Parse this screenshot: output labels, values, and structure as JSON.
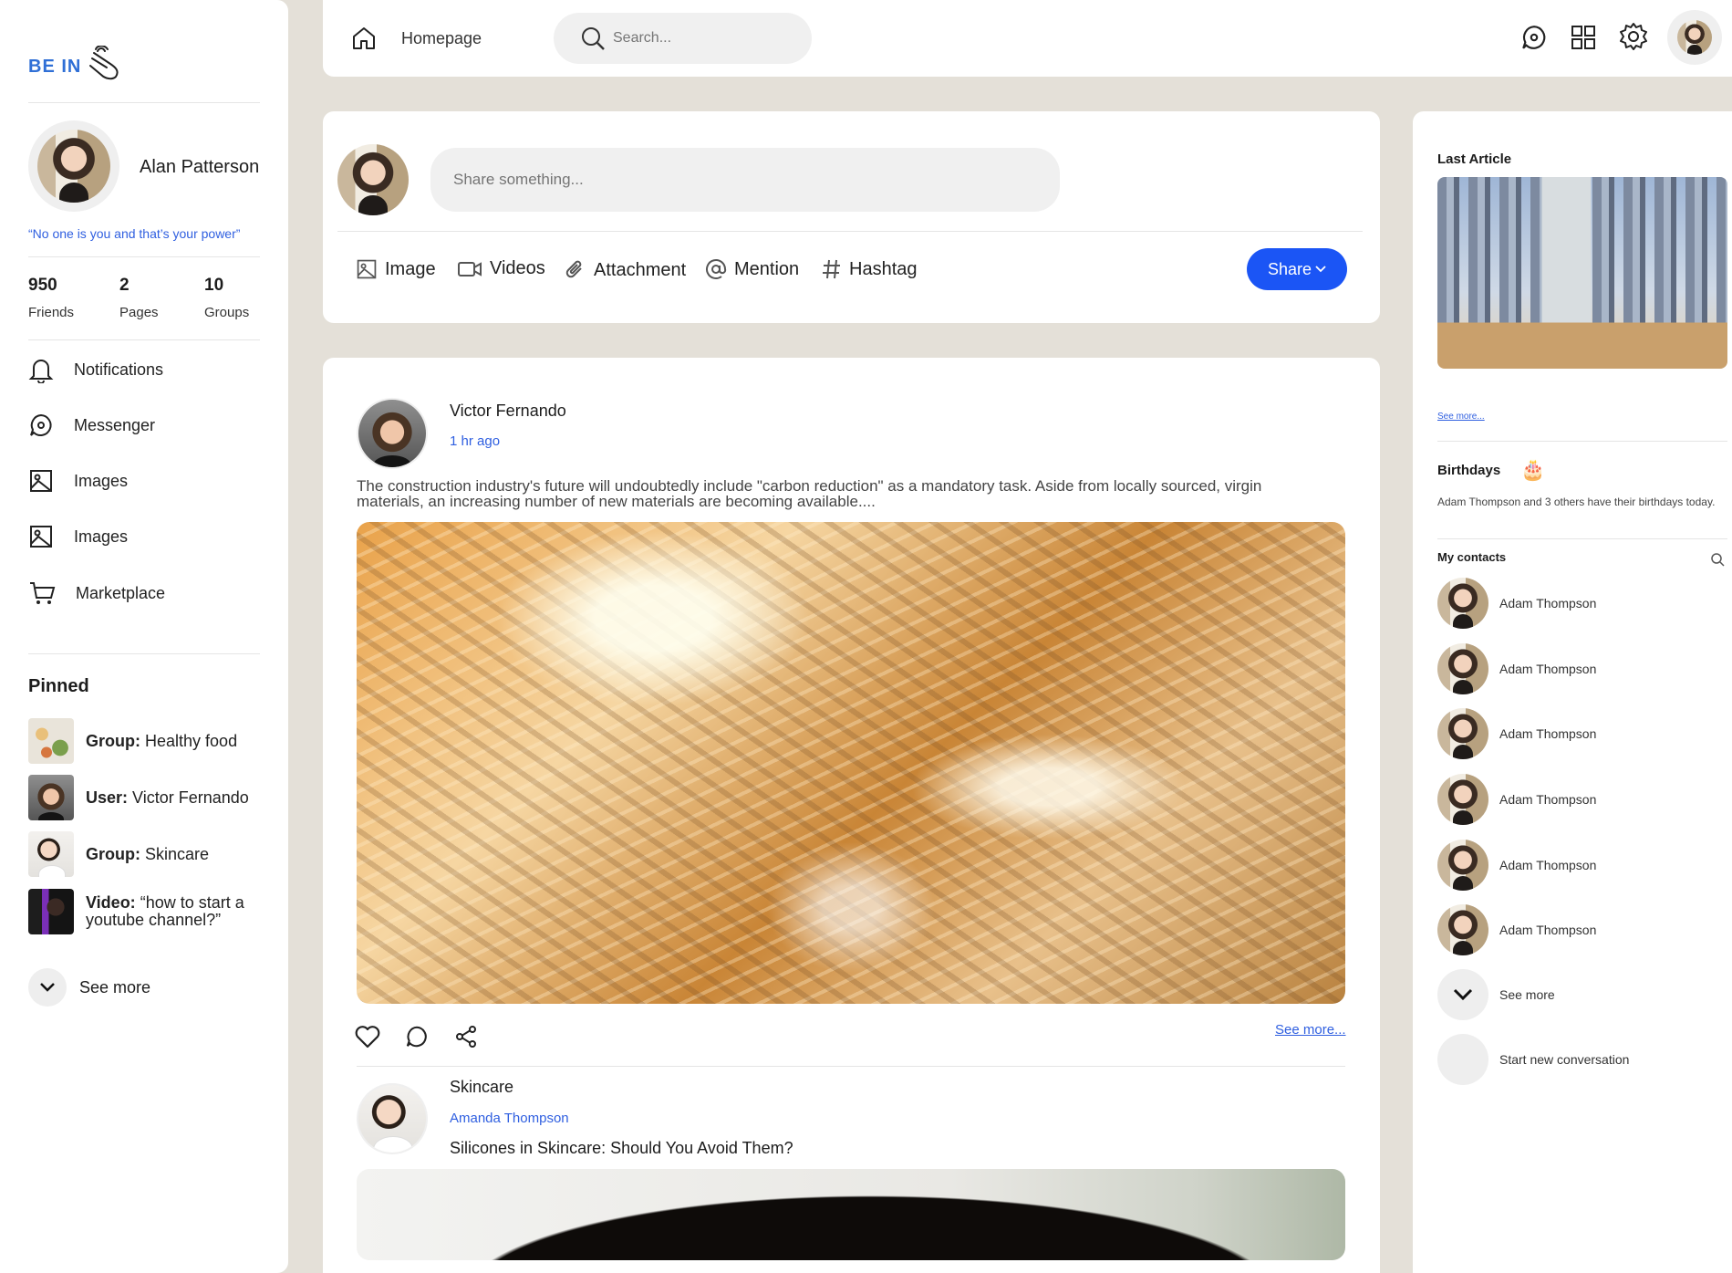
{
  "brand": {
    "logo_text": "BE IN"
  },
  "profile": {
    "name": "Alan Patterson",
    "quote": "“No one is you and that’s your power”",
    "stats": [
      {
        "value": "950",
        "label": "Friends"
      },
      {
        "value": "2",
        "label": "Pages"
      },
      {
        "value": "10",
        "label": "Groups"
      }
    ]
  },
  "sidebar": {
    "items": [
      {
        "label": "Notifications",
        "icon": "bell-icon"
      },
      {
        "label": "Messenger",
        "icon": "chat-icon"
      },
      {
        "label": "Images",
        "icon": "image-icon"
      },
      {
        "label": "Images",
        "icon": "image-icon"
      },
      {
        "label": "Marketplace",
        "icon": "cart-icon"
      }
    ],
    "pinned_title": "Pinned",
    "pinned": [
      {
        "prefix": "Group:",
        "text": "Healthy food"
      },
      {
        "prefix": "User:",
        "text": "Victor Fernando"
      },
      {
        "prefix": "Group:",
        "text": "Skincare"
      },
      {
        "prefix": "Video:",
        "text": "“how to start a youtube channel?”"
      }
    ],
    "see_more": "See more"
  },
  "topbar": {
    "home_label": "Homepage",
    "search_placeholder": "Search...",
    "icons": [
      "chat-icon",
      "grid-icon",
      "gear-icon",
      "avatar"
    ]
  },
  "composer": {
    "placeholder": "Share something...",
    "tools": [
      "Image",
      "Videos",
      "Attachment",
      "Mention",
      "Hashtag"
    ],
    "share_label": "Share"
  },
  "posts": [
    {
      "author": "Victor Fernando",
      "time": "1 hr ago",
      "text": "The construction industry's future will undoubtedly include \"carbon reduction\" as a mandatory task. Aside from locally sourced, virgin materials, an increasing number of new materials are becoming available....",
      "see_more": "See more..."
    },
    {
      "group": "Skincare",
      "author": "Amanda Thompson",
      "title": "Silicones in Skincare: Should You Avoid Them?"
    }
  ],
  "right": {
    "article_title": "Last Article",
    "article_see_more": "See more...",
    "birthdays_title": "Birthdays",
    "birthdays_text": "Adam Thompson and 3 others have their birthdays today.",
    "contacts_title": "My contacts",
    "contacts": [
      "Adam Thompson",
      "Adam Thompson",
      "Adam Thompson",
      "Adam Thompson",
      "Adam Thompson",
      "Adam Thompson"
    ],
    "see_more": "See more",
    "new_conversation": "Start new conversation"
  },
  "colors": {
    "accent": "#1b55f5",
    "link": "#2f5fe0",
    "page_bg": "#e4e0d8"
  }
}
